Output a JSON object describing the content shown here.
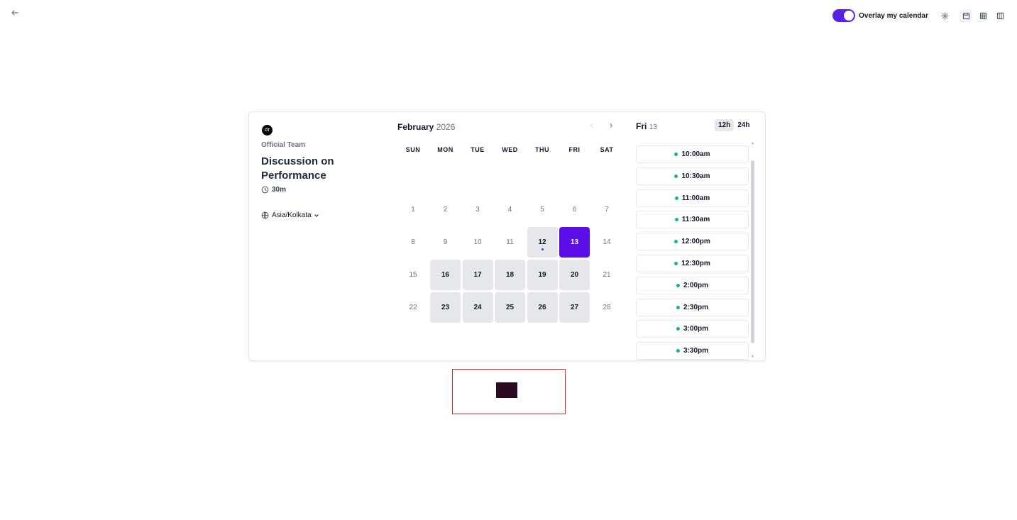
{
  "toolbar": {
    "overlay_label": "Overlay my calendar",
    "overlay_enabled": true
  },
  "profile": {
    "initials": "OT",
    "team_name": "Official Team"
  },
  "event": {
    "title": "Discussion on Performance",
    "duration": "30m",
    "timezone": "Asia/Kolkata"
  },
  "calendar": {
    "month": "February",
    "year": "2026",
    "weekdays": [
      "SUN",
      "MON",
      "TUE",
      "WED",
      "THU",
      "FRI",
      "SAT"
    ],
    "weeks": [
      [
        {
          "d": "1"
        },
        {
          "d": "2"
        },
        {
          "d": "3"
        },
        {
          "d": "4"
        },
        {
          "d": "5"
        },
        {
          "d": "6"
        },
        {
          "d": "7"
        }
      ],
      [
        {
          "d": "8"
        },
        {
          "d": "9"
        },
        {
          "d": "10"
        },
        {
          "d": "11"
        },
        {
          "d": "12",
          "state": "available",
          "today": true
        },
        {
          "d": "13",
          "state": "selected"
        },
        {
          "d": "14"
        }
      ],
      [
        {
          "d": "15"
        },
        {
          "d": "16",
          "state": "available"
        },
        {
          "d": "17",
          "state": "available"
        },
        {
          "d": "18",
          "state": "available"
        },
        {
          "d": "19",
          "state": "available"
        },
        {
          "d": "20",
          "state": "available"
        },
        {
          "d": "21"
        }
      ],
      [
        {
          "d": "22"
        },
        {
          "d": "23",
          "state": "available"
        },
        {
          "d": "24",
          "state": "available"
        },
        {
          "d": "25",
          "state": "available"
        },
        {
          "d": "26",
          "state": "available"
        },
        {
          "d": "27",
          "state": "available"
        },
        {
          "d": "28"
        }
      ]
    ]
  },
  "slots": {
    "day_label": "Fri",
    "day_number": "13",
    "format_12h": "12h",
    "format_24h": "24h",
    "active_format": "12h",
    "times": [
      "10:00am",
      "10:30am",
      "11:00am",
      "11:30am",
      "12:00pm",
      "12:30pm",
      "2:00pm",
      "2:30pm",
      "3:00pm",
      "3:30pm"
    ]
  },
  "colors": {
    "accent": "#5b0ee8",
    "available_day": "#e5e7eb",
    "slot_dot": "#10b981",
    "red_box": "#dc2626"
  }
}
